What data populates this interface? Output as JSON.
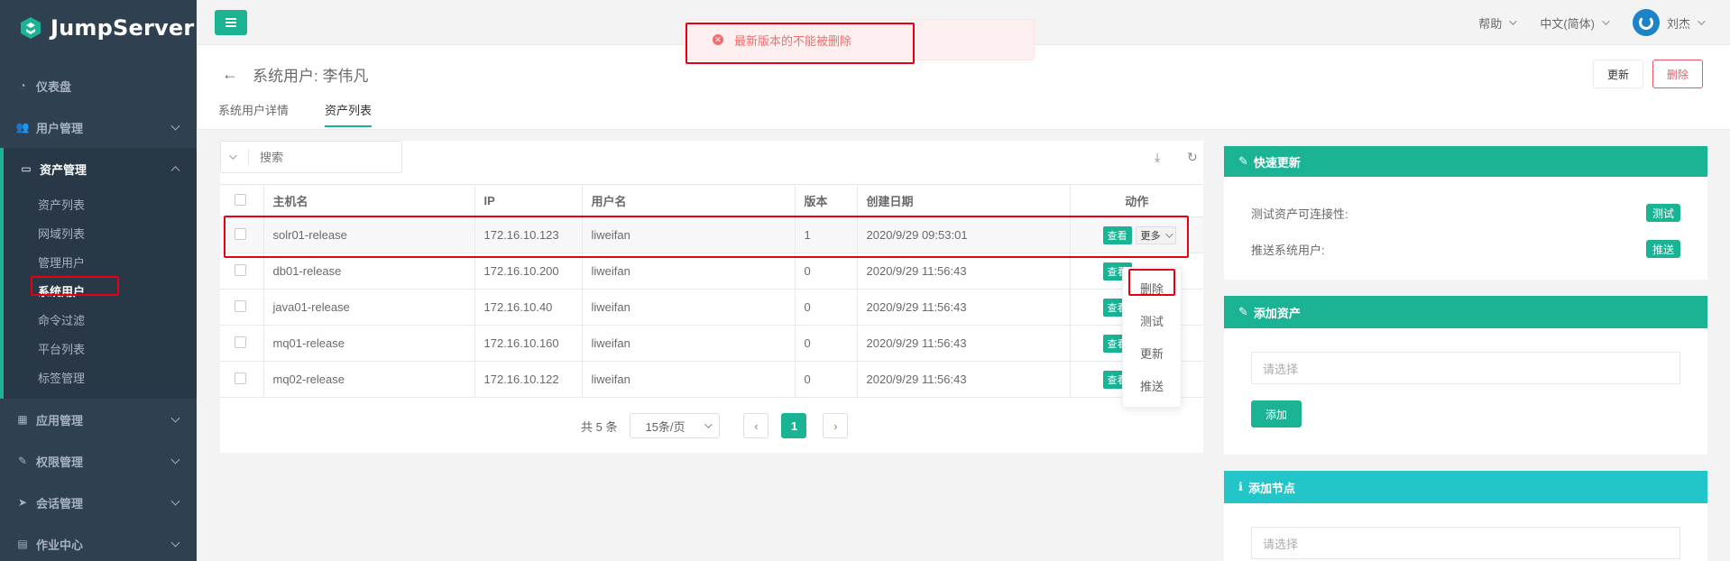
{
  "app": {
    "name": "JumpServer"
  },
  "sidebar": {
    "items": [
      {
        "label": "仪表盘",
        "icon": "dashboard-icon"
      },
      {
        "label": "用户管理",
        "icon": "users-icon"
      },
      {
        "label": "资产管理",
        "icon": "hdd-icon"
      },
      {
        "label": "应用管理",
        "icon": "grid-icon"
      },
      {
        "label": "权限管理",
        "icon": "edit-icon"
      },
      {
        "label": "会话管理",
        "icon": "rocket-icon"
      },
      {
        "label": "作业中心",
        "icon": "tasks-icon"
      }
    ],
    "asset_sub": [
      "资产列表",
      "网域列表",
      "管理用户",
      "系统用户",
      "命令过滤",
      "平台列表",
      "标签管理"
    ]
  },
  "topbar": {
    "help": "帮助",
    "language": "中文(简体)",
    "user": "刘杰"
  },
  "toast": {
    "message": "最新版本的不能被删除"
  },
  "page": {
    "title": "系统用户: 李伟凡",
    "tabs": [
      "系统用户详情",
      "资产列表"
    ],
    "update_label": "更新",
    "delete_label": "删除"
  },
  "search": {
    "placeholder": "搜索"
  },
  "table": {
    "columns": [
      "主机名",
      "IP",
      "用户名",
      "版本",
      "创建日期",
      "动作"
    ],
    "rows": [
      {
        "hostname": "solr01-release",
        "ip": "172.16.10.123",
        "username": "liweifan",
        "version": "1",
        "created": "2020/9/29 09:53:01"
      },
      {
        "hostname": "db01-release",
        "ip": "172.16.10.200",
        "username": "liweifan",
        "version": "0",
        "created": "2020/9/29 11:56:43"
      },
      {
        "hostname": "java01-release",
        "ip": "172.16.10.40",
        "username": "liweifan",
        "version": "0",
        "created": "2020/9/29 11:56:43"
      },
      {
        "hostname": "mq01-release",
        "ip": "172.16.10.160",
        "username": "liweifan",
        "version": "0",
        "created": "2020/9/29 11:56:43"
      },
      {
        "hostname": "mq02-release",
        "ip": "172.16.10.122",
        "username": "liweifan",
        "version": "0",
        "created": "2020/9/29 11:56:43"
      }
    ],
    "view_label": "查看",
    "more_label": "更多"
  },
  "pagination": {
    "total": "共 5 条",
    "page_size": "15条/页",
    "current": "1"
  },
  "more_menu": [
    "删除",
    "测试",
    "更新",
    "推送"
  ],
  "quick_update": {
    "title": "快速更新",
    "test_label": "测试资产可连接性:",
    "test_btn": "测试",
    "push_label": "推送系统用户:",
    "push_btn": "推送"
  },
  "add_asset": {
    "title": "添加资产",
    "placeholder": "请选择",
    "btn": "添加"
  },
  "add_node": {
    "title": "添加节点",
    "placeholder": "请选择"
  },
  "colors": {
    "accent": "#1ab394",
    "sidebar": "#2f4050",
    "danger": "#ed5565",
    "highlight": "#e60012"
  }
}
